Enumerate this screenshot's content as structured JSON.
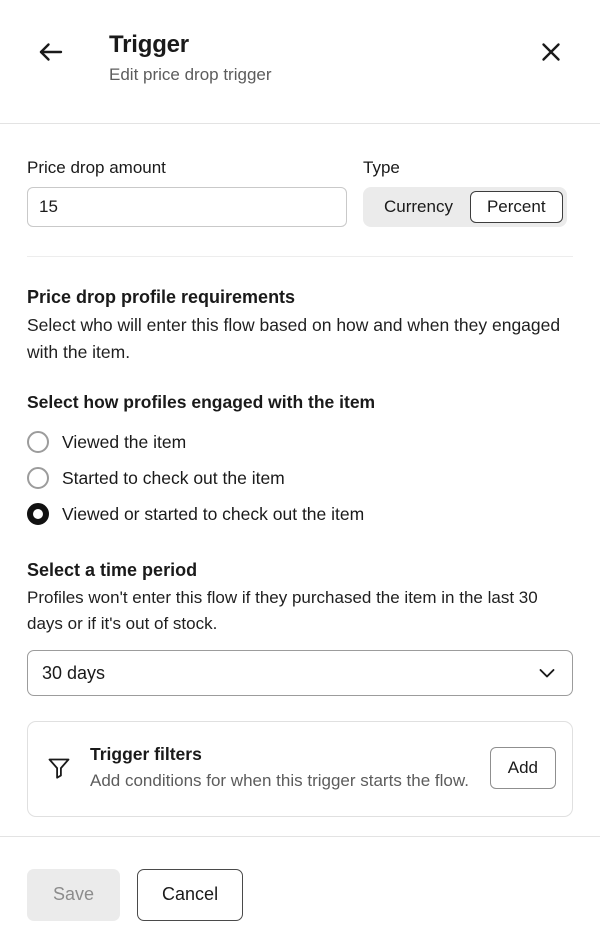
{
  "header": {
    "back_icon": "arrow-left-icon",
    "title": "Trigger",
    "subtitle": "Edit price drop trigger",
    "close_icon": "close-icon"
  },
  "amount_field": {
    "label": "Price drop amount",
    "value": "15",
    "placeholder": ""
  },
  "type_field": {
    "label": "Type",
    "options": [
      {
        "label": "Currency",
        "selected": false
      },
      {
        "label": "Percent",
        "selected": true
      }
    ],
    "selected": "Percent"
  },
  "requirements": {
    "title": "Price drop profile requirements",
    "description": "Select who will enter this flow based on how and when they engaged with the item.",
    "engagement_title": "Select how profiles engaged with the item",
    "engagement_options": [
      {
        "label": "Viewed the item",
        "selected": false
      },
      {
        "label": "Started to check out the item",
        "selected": false
      },
      {
        "label": "Viewed or started to check out the item",
        "selected": true
      }
    ]
  },
  "time_period": {
    "title": "Select a time period",
    "description": "Profiles won't enter this flow if they purchased the item in the last 30 days or if it's out of stock.",
    "selected": "30 days",
    "chevron_icon": "chevron-down-icon",
    "options": [
      "30 days"
    ]
  },
  "trigger_filters": {
    "icon": "filter-funnel-icon",
    "title": "Trigger filters",
    "description": "Add conditions for when this trigger starts the flow.",
    "add_label": "Add"
  },
  "footer": {
    "save_label": "Save",
    "cancel_label": "Cancel"
  },
  "colors": {
    "text": "#1a1a1a",
    "muted": "#5c5c5c",
    "border": "#c9c9c9",
    "segment_bg": "#ebebeb",
    "disabled_bg": "#ebebeb",
    "disabled_text": "#8c8c8c"
  }
}
